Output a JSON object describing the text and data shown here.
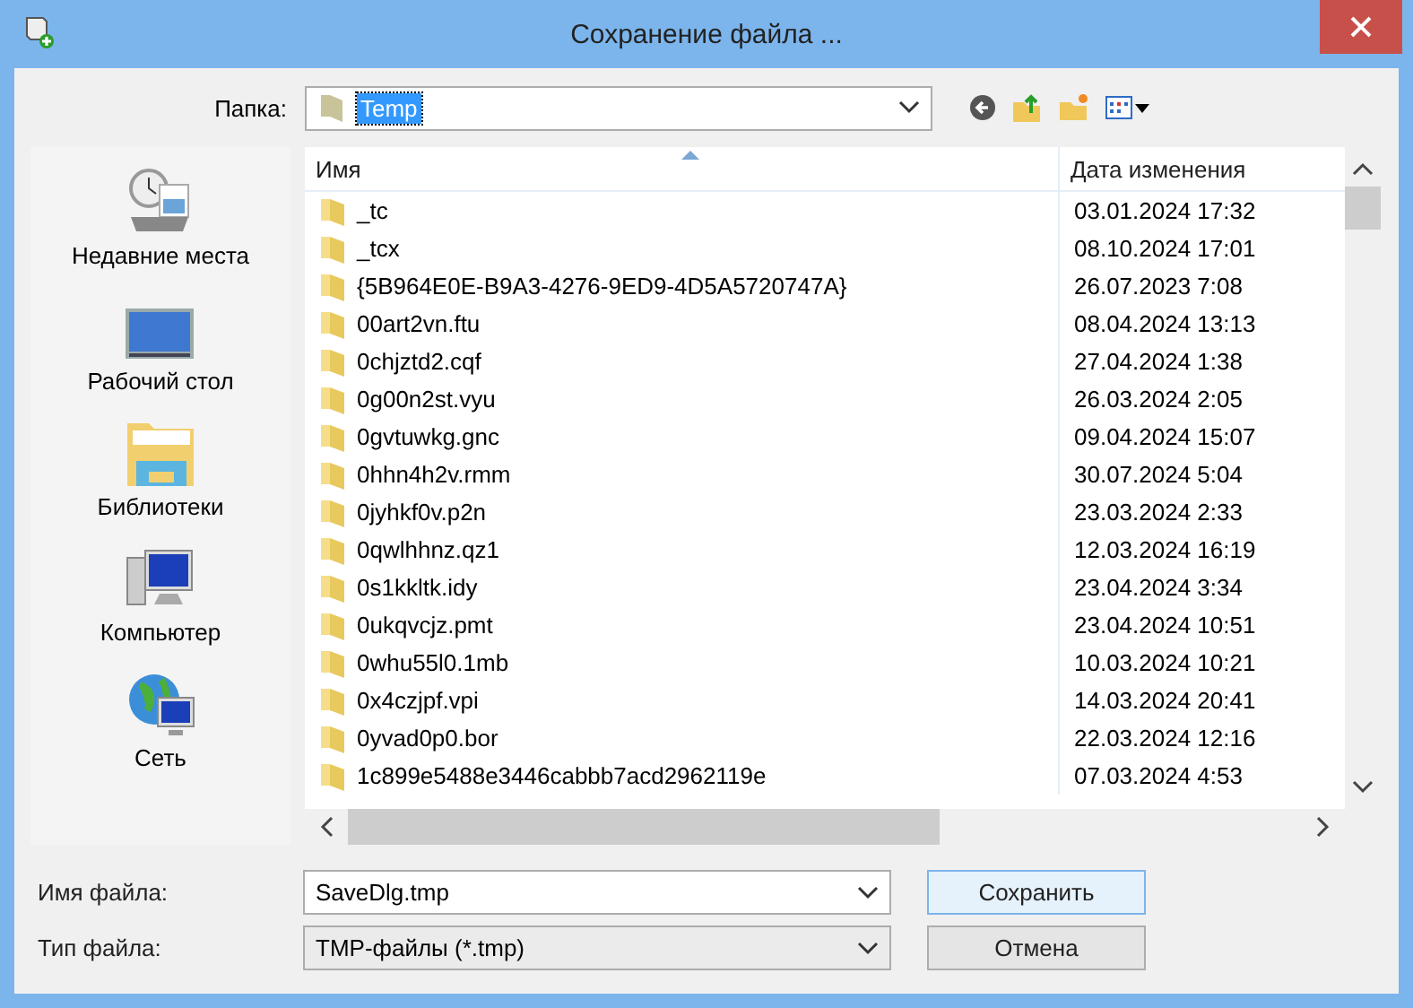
{
  "window": {
    "title": "Сохранение файла ..."
  },
  "location": {
    "label": "Папка:",
    "value": "Temp",
    "highlighted": true
  },
  "places": [
    {
      "label": "Недавние места",
      "kind": "recent"
    },
    {
      "label": "Рабочий стол",
      "kind": "desktop"
    },
    {
      "label": "Библиотеки",
      "kind": "libraries"
    },
    {
      "label": "Компьютер",
      "kind": "computer"
    },
    {
      "label": "Сеть",
      "kind": "network"
    }
  ],
  "columns": [
    {
      "label": "Имя",
      "sorted": true
    },
    {
      "label": "Дата изменения",
      "sorted": false
    }
  ],
  "rows": [
    {
      "name": "_tc",
      "date": "03.01.2024 17:32"
    },
    {
      "name": "_tcx",
      "date": "08.10.2024 17:01"
    },
    {
      "name": "{5B964E0E-B9A3-4276-9ED9-4D5A5720747A}",
      "date": "26.07.2023 7:08"
    },
    {
      "name": "00art2vn.ftu",
      "date": "08.04.2024 13:13"
    },
    {
      "name": "0chjztd2.cqf",
      "date": "27.04.2024 1:38"
    },
    {
      "name": "0g00n2st.vyu",
      "date": "26.03.2024 2:05"
    },
    {
      "name": "0gvtuwkg.gnc",
      "date": "09.04.2024 15:07"
    },
    {
      "name": "0hhn4h2v.rmm",
      "date": "30.07.2024 5:04"
    },
    {
      "name": "0jyhkf0v.p2n",
      "date": "23.03.2024 2:33"
    },
    {
      "name": "0qwlhhnz.qz1",
      "date": "12.03.2024 16:19"
    },
    {
      "name": "0s1kkltk.idy",
      "date": "23.04.2024 3:34"
    },
    {
      "name": "0ukqvcjz.pmt",
      "date": "23.04.2024 10:51"
    },
    {
      "name": "0whu55l0.1mb",
      "date": "10.03.2024 10:21"
    },
    {
      "name": "0x4czjpf.vpi",
      "date": "14.03.2024 20:41"
    },
    {
      "name": "0yvad0p0.bor",
      "date": "22.03.2024 12:16"
    },
    {
      "name": "1c899e5488e3446cabbb7acd2962119e",
      "date": "07.03.2024 4:53"
    }
  ],
  "filename": {
    "label": "Имя файла:",
    "value": "SaveDlg.tmp"
  },
  "filetype": {
    "label": "Тип файла:",
    "value": "TMP-файлы (*.tmp)"
  },
  "buttons": [
    {
      "label": "Сохранить",
      "default": true
    },
    {
      "label": "Отмена",
      "default": false
    }
  ]
}
